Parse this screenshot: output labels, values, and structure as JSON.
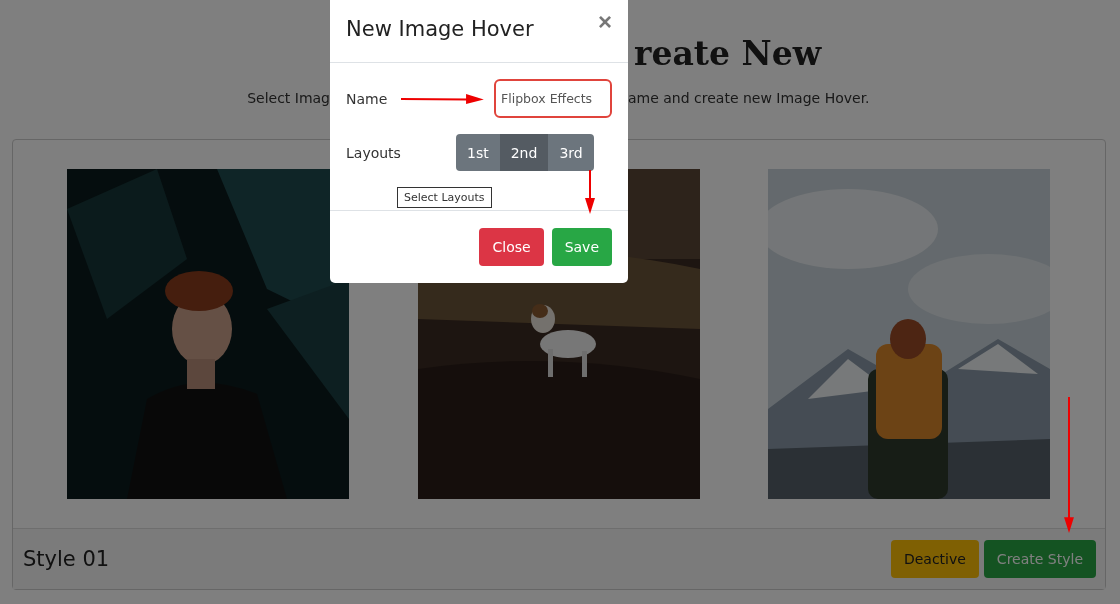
{
  "page": {
    "heading": "reate New",
    "subtitle_left": "Select Imag",
    "subtitle_right": "ame and create new Image Hover."
  },
  "gallery": {
    "title": "Style 01",
    "buttons": [
      {
        "label": "Deactive",
        "kind": "warning"
      },
      {
        "label": "Create Style",
        "kind": "success"
      }
    ]
  },
  "modal": {
    "title": "New Image Hover",
    "close": "×",
    "name_label": "Name",
    "name_value": "Flipbox Effects",
    "layouts_label": "Layouts",
    "layouts": [
      {
        "label": "1st",
        "selected": false
      },
      {
        "label": "2nd",
        "selected": true
      },
      {
        "label": "3rd",
        "selected": false
      }
    ],
    "tooltip": "Select Layouts",
    "buttons": [
      {
        "label": "Close",
        "kind": "danger"
      },
      {
        "label": "Save",
        "kind": "success"
      }
    ]
  }
}
